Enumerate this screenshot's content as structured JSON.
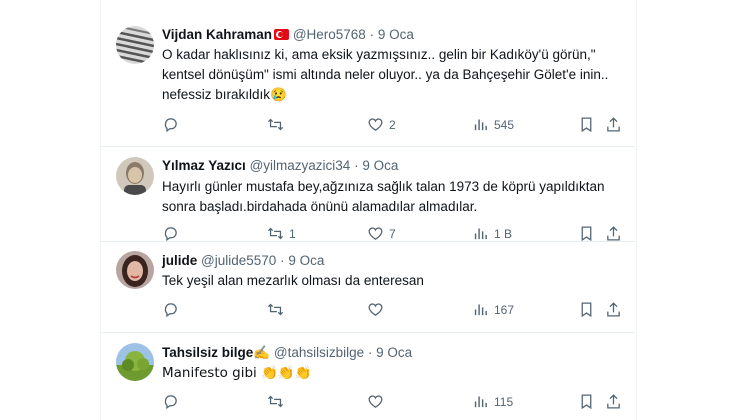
{
  "tweets": [
    {
      "name": "Vijdan Kahraman",
      "handle": "@Hero5768",
      "date": "9 Oca",
      "text": "O kadar haklısınız ki, ama eksik yazmışsınız.. gelin bir Kadıköy'ü görün,\" kentsel dönüşüm\" ismi altında neler oluyor.. ya da Bahçeşehir Gölet'e inin.. nefessiz bırakıldık😢",
      "replies": "",
      "retweets": "",
      "likes": "2",
      "views": "545"
    },
    {
      "name": "Yılmaz Yazıcı",
      "handle": "@yilmazyazici34",
      "date": "9 Oca",
      "text": "Hayırlı günler mustafa bey,ağzınıza sağlık talan 1973 de köprü yapıldıktan sonra başladı.birdahada önünü alamadılar almadılar.",
      "replies": "",
      "retweets": "1",
      "likes": "7",
      "views": "1 B"
    },
    {
      "name": "julide",
      "handle": "@julide5570",
      "date": "9 Oca",
      "text": "Tek yeşil alan mezarlık olması da enteresan",
      "replies": "",
      "retweets": "",
      "likes": "",
      "views": "167"
    },
    {
      "name": "Tahsilsiz bilge✍️",
      "handle": "@tahsilsizbilge",
      "date": "9 Oca",
      "text": "Manifesto gibi 👏👏👏",
      "replies": "",
      "retweets": "",
      "likes": "",
      "views": "115"
    }
  ],
  "icons": {
    "reply": "reply-icon",
    "retweet": "retweet-icon",
    "like": "heart-icon",
    "views": "views-icon",
    "bookmark": "bookmark-icon",
    "share": "share-icon",
    "flag": "turkey-flag-icon"
  },
  "colors": {
    "text": "#0f1419",
    "secondary": "#536471",
    "divider": "#e6ecf0"
  }
}
